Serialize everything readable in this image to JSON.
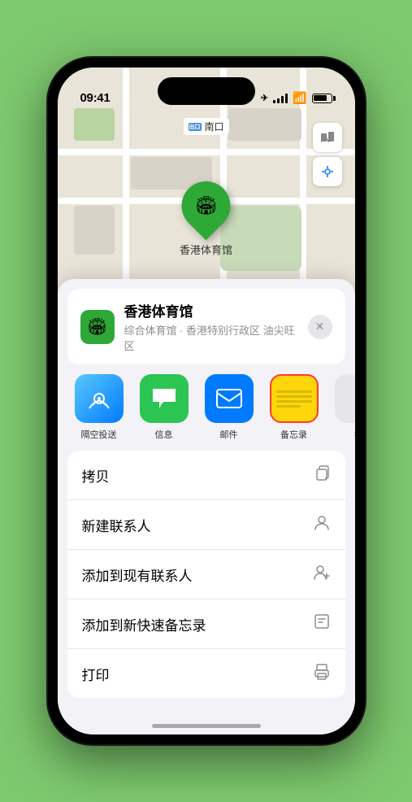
{
  "status_bar": {
    "time": "09:41",
    "location_arrow": "▶"
  },
  "map": {
    "label_text": "南口",
    "label_prefix": "出口",
    "pin_emoji": "🏟",
    "pin_label": "香港体育馆"
  },
  "location_card": {
    "name": "香港体育馆",
    "subtitle": "综合体育馆 · 香港特别行政区 油尖旺区",
    "close_label": "✕"
  },
  "share_items": [
    {
      "id": "airdrop",
      "label": "隔空投送"
    },
    {
      "id": "messages",
      "label": "信息"
    },
    {
      "id": "mail",
      "label": "邮件"
    },
    {
      "id": "notes",
      "label": "备忘录"
    },
    {
      "id": "more",
      "label": "推"
    }
  ],
  "action_items": [
    {
      "label": "拷贝",
      "icon": "copy"
    },
    {
      "label": "新建联系人",
      "icon": "person"
    },
    {
      "label": "添加到现有联系人",
      "icon": "person-add"
    },
    {
      "label": "添加到新快速备忘录",
      "icon": "note"
    },
    {
      "label": "打印",
      "icon": "print"
    }
  ]
}
